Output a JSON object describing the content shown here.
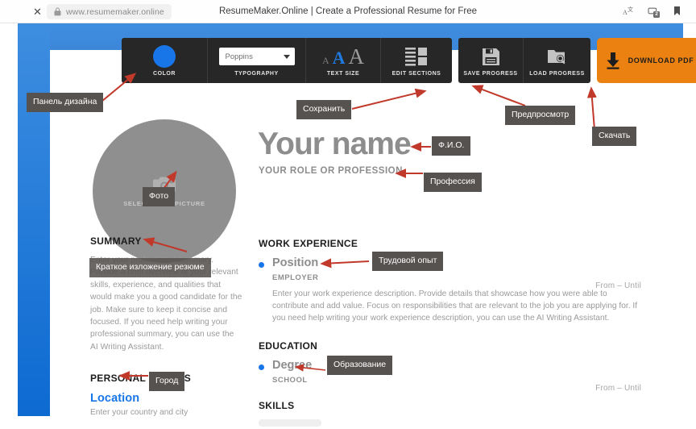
{
  "browser": {
    "close_label": "✕",
    "url": "www.resumemaker.online",
    "page_title": "ResumeMaker.Online | Create a Professional Resume for Free",
    "icons": {
      "lock": "lock-icon",
      "translate": "translate-icon",
      "tabs": "tabs-icon",
      "tab_count": "2",
      "bookmark": "bookmark-icon"
    }
  },
  "toolbar": {
    "color_label": "COLOR",
    "color_value": "#1976e8",
    "typography_label": "TYPOGRAPHY",
    "font_value": "Poppins",
    "text_size_label": "TEXT SIZE",
    "text_size_options": [
      "A",
      "A",
      "A"
    ],
    "text_size_selected_index": 1,
    "edit_sections_label": "EDIT SECTIONS",
    "save_progress_label": "SAVE PROGRESS",
    "load_progress_label": "LOAD PROGRESS",
    "download_label": "DOWNLOAD PDF",
    "download_color": "#eb8111"
  },
  "resume": {
    "photo_placeholder": "SELECT YOUR PICTURE",
    "name": "Your name",
    "role": "YOUR ROLE OR PROFESSION",
    "summary_heading": "SUMMARY",
    "summary_text": "Enter your professional summary. Provide a brief overview of your relevant skills, experience, and qualities that would make you a good candidate for the job. Make sure to keep it concise and focused. If you need help writing your professional summary, you can use the AI Writing Assistant.",
    "personal_details_heading": "PERSONAL DETAILS",
    "location_label": "Location",
    "location_hint": "Enter your country and city",
    "work_heading": "WORK EXPERIENCE",
    "work_position": "Position",
    "work_employer": "EMPLOYER",
    "work_date": "From – Until",
    "work_desc": "Enter your work experience description. Provide details that showcase how you were able to contribute and add value. Focus on responsibilities that are relevant to the job you are applying for. If you need help writing your work experience description, you can use the AI Writing Assistant.",
    "education_heading": "EDUCATION",
    "education_degree": "Degree",
    "education_school": "SCHOOL",
    "education_date": "From – Until",
    "skills_heading": "SKILLS"
  },
  "annotations": {
    "design_panel": "Панель дизайна",
    "photo": "Фото",
    "save": "Сохранить",
    "preview": "Предпросмотр",
    "download": "Скачать",
    "full_name": "Ф.И.О.",
    "profession": "Профессия",
    "summary": "Краткое изложение резюме",
    "city": "Город",
    "work_experience": "Трудовой опыт",
    "education": "Образование",
    "arrow_color": "#c0392b"
  }
}
